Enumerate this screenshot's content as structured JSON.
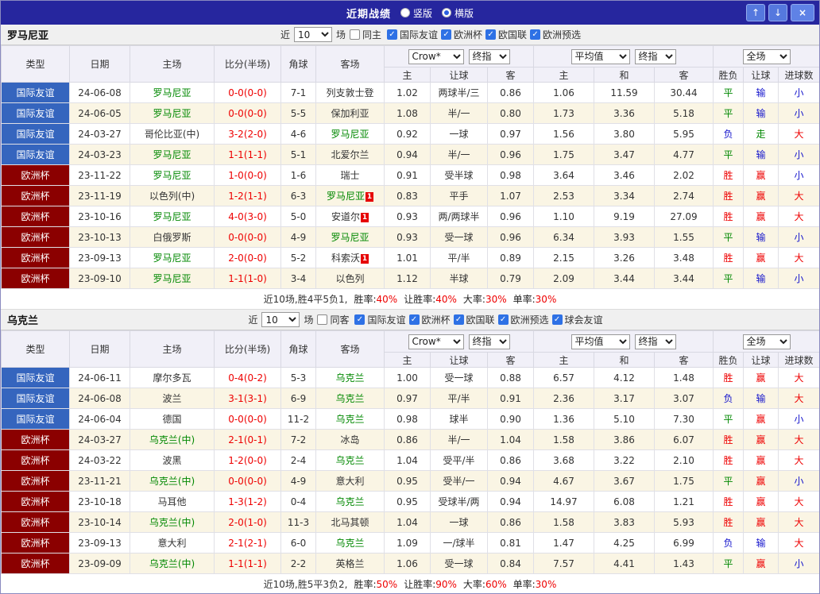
{
  "titlebar": {
    "title": "近期战绩",
    "radios": [
      {
        "label": "竖版",
        "selected": false
      },
      {
        "label": "横版",
        "selected": true
      }
    ],
    "buttons": {
      "up": "↑",
      "down": "↓",
      "close": "×"
    }
  },
  "type_colors": {
    "国际友谊": "#3565be",
    "欧洲杯": "#8b0000"
  },
  "result_colors": {
    "胜": "red",
    "平": "green",
    "负": "blue",
    "赢": "red",
    "走": "green",
    "输": "blue",
    "大": "red",
    "小": "blue"
  },
  "table": {
    "cols": {
      "type": "类型",
      "date": "日期",
      "home": "主场",
      "score": "比分(半场)",
      "corner": "角球",
      "away": "客场"
    },
    "selects": {
      "company": "Crow*",
      "stage1": "终指",
      "average": "平均值",
      "stage2": "终指",
      "scope": "全场"
    },
    "sub": [
      "主",
      "让球",
      "客",
      "主",
      "和",
      "客",
      "胜负",
      "让球",
      "进球数"
    ]
  },
  "sections": [
    {
      "team": "罗马尼亚",
      "filters": {
        "near_label": "近",
        "count": "10",
        "games_label": "场",
        "same": {
          "label": "同主",
          "checked": false
        },
        "comps": [
          {
            "label": "国际友谊",
            "checked": true
          },
          {
            "label": "欧洲杯",
            "checked": true
          },
          {
            "label": "欧国联",
            "checked": true
          },
          {
            "label": "欧洲预选",
            "checked": true
          }
        ]
      },
      "rows": [
        {
          "type": "国际友谊",
          "date": "24-06-08",
          "home": {
            "name": "罗马尼亚",
            "hl": true
          },
          "score": "0-0(0-0)",
          "corner": "7-1",
          "away": {
            "name": "列支敦士登",
            "hl": false
          },
          "odds": [
            "1.02",
            "两球半/三",
            "0.86",
            "1.06",
            "11.59",
            "30.44"
          ],
          "results": [
            "平",
            "输",
            "小"
          ]
        },
        {
          "type": "国际友谊",
          "date": "24-06-05",
          "home": {
            "name": "罗马尼亚",
            "hl": true
          },
          "score": "0-0(0-0)",
          "corner": "5-5",
          "away": {
            "name": "保加利亚",
            "hl": false
          },
          "odds": [
            "1.08",
            "半/一",
            "0.80",
            "1.73",
            "3.36",
            "5.18"
          ],
          "results": [
            "平",
            "输",
            "小"
          ]
        },
        {
          "type": "国际友谊",
          "date": "24-03-27",
          "home": {
            "name": "哥伦比亚(中)",
            "hl": false
          },
          "score": "3-2(2-0)",
          "corner": "4-6",
          "away": {
            "name": "罗马尼亚",
            "hl": true
          },
          "odds": [
            "0.92",
            "一球",
            "0.97",
            "1.56",
            "3.80",
            "5.95"
          ],
          "results": [
            "负",
            "走",
            "大"
          ]
        },
        {
          "type": "国际友谊",
          "date": "24-03-23",
          "home": {
            "name": "罗马尼亚",
            "hl": true
          },
          "score": "1-1(1-1)",
          "corner": "5-1",
          "away": {
            "name": "北爱尔兰",
            "hl": false
          },
          "odds": [
            "0.94",
            "半/一",
            "0.96",
            "1.75",
            "3.47",
            "4.77"
          ],
          "results": [
            "平",
            "输",
            "小"
          ]
        },
        {
          "type": "欧洲杯",
          "date": "23-11-22",
          "home": {
            "name": "罗马尼亚",
            "hl": true
          },
          "score": "1-0(0-0)",
          "corner": "1-6",
          "away": {
            "name": "瑞士",
            "hl": false
          },
          "odds": [
            "0.91",
            "受半球",
            "0.98",
            "3.64",
            "3.46",
            "2.02"
          ],
          "results": [
            "胜",
            "赢",
            "小"
          ]
        },
        {
          "type": "欧洲杯",
          "date": "23-11-19",
          "home": {
            "name": "以色列(中)",
            "hl": false
          },
          "score": "1-2(1-1)",
          "corner": "6-3",
          "away": {
            "name": "罗马尼亚",
            "hl": true,
            "card": "1"
          },
          "odds": [
            "0.83",
            "平手",
            "1.07",
            "2.53",
            "3.34",
            "2.74"
          ],
          "results": [
            "胜",
            "赢",
            "大"
          ]
        },
        {
          "type": "欧洲杯",
          "date": "23-10-16",
          "home": {
            "name": "罗马尼亚",
            "hl": true
          },
          "score": "4-0(3-0)",
          "corner": "5-0",
          "away": {
            "name": "安道尔",
            "hl": false,
            "card": "1"
          },
          "odds": [
            "0.93",
            "两/两球半",
            "0.96",
            "1.10",
            "9.19",
            "27.09"
          ],
          "results": [
            "胜",
            "赢",
            "大"
          ]
        },
        {
          "type": "欧洲杯",
          "date": "23-10-13",
          "home": {
            "name": "白俄罗斯",
            "hl": false
          },
          "score": "0-0(0-0)",
          "corner": "4-9",
          "away": {
            "name": "罗马尼亚",
            "hl": true
          },
          "odds": [
            "0.93",
            "受一球",
            "0.96",
            "6.34",
            "3.93",
            "1.55"
          ],
          "results": [
            "平",
            "输",
            "小"
          ]
        },
        {
          "type": "欧洲杯",
          "date": "23-09-13",
          "home": {
            "name": "罗马尼亚",
            "hl": true
          },
          "score": "2-0(0-0)",
          "corner": "5-2",
          "away": {
            "name": "科索沃",
            "hl": false,
            "card": "1"
          },
          "odds": [
            "1.01",
            "平/半",
            "0.89",
            "2.15",
            "3.26",
            "3.48"
          ],
          "results": [
            "胜",
            "赢",
            "大"
          ]
        },
        {
          "type": "欧洲杯",
          "date": "23-09-10",
          "home": {
            "name": "罗马尼亚",
            "hl": true
          },
          "score": "1-1(1-0)",
          "corner": "3-4",
          "away": {
            "name": "以色列",
            "hl": false
          },
          "odds": [
            "1.12",
            "半球",
            "0.79",
            "2.09",
            "3.44",
            "3.44"
          ],
          "results": [
            "平",
            "输",
            "小"
          ]
        }
      ],
      "footer": {
        "summary": "近10场,胜4平5负1,",
        "stats": [
          {
            "label": "胜率:",
            "value": "40%"
          },
          {
            "label": "让胜率:",
            "value": "40%"
          },
          {
            "label": "大率:",
            "value": "30%"
          },
          {
            "label": "单率:",
            "value": "30%"
          }
        ]
      }
    },
    {
      "team": "乌克兰",
      "filters": {
        "near_label": "近",
        "count": "10",
        "games_label": "场",
        "same": {
          "label": "同客",
          "checked": false
        },
        "comps": [
          {
            "label": "国际友谊",
            "checked": true
          },
          {
            "label": "欧洲杯",
            "checked": true
          },
          {
            "label": "欧国联",
            "checked": true
          },
          {
            "label": "欧洲预选",
            "checked": true
          },
          {
            "label": "球会友谊",
            "checked": true
          }
        ]
      },
      "rows": [
        {
          "type": "国际友谊",
          "date": "24-06-11",
          "home": {
            "name": "摩尔多瓦",
            "hl": false
          },
          "score": "0-4(0-2)",
          "corner": "5-3",
          "away": {
            "name": "乌克兰",
            "hl": true
          },
          "odds": [
            "1.00",
            "受一球",
            "0.88",
            "6.57",
            "4.12",
            "1.48"
          ],
          "results": [
            "胜",
            "赢",
            "大"
          ]
        },
        {
          "type": "国际友谊",
          "date": "24-06-08",
          "home": {
            "name": "波兰",
            "hl": false
          },
          "score": "3-1(3-1)",
          "corner": "6-9",
          "away": {
            "name": "乌克兰",
            "hl": true
          },
          "odds": [
            "0.97",
            "平/半",
            "0.91",
            "2.36",
            "3.17",
            "3.07"
          ],
          "results": [
            "负",
            "输",
            "大"
          ]
        },
        {
          "type": "国际友谊",
          "date": "24-06-04",
          "home": {
            "name": "德国",
            "hl": false
          },
          "score": "0-0(0-0)",
          "corner": "11-2",
          "away": {
            "name": "乌克兰",
            "hl": true
          },
          "odds": [
            "0.98",
            "球半",
            "0.90",
            "1.36",
            "5.10",
            "7.30"
          ],
          "results": [
            "平",
            "赢",
            "小"
          ]
        },
        {
          "type": "欧洲杯",
          "date": "24-03-27",
          "home": {
            "name": "乌克兰(中)",
            "hl": true
          },
          "score": "2-1(0-1)",
          "corner": "7-2",
          "away": {
            "name": "冰岛",
            "hl": false
          },
          "odds": [
            "0.86",
            "半/一",
            "1.04",
            "1.58",
            "3.86",
            "6.07"
          ],
          "results": [
            "胜",
            "赢",
            "大"
          ]
        },
        {
          "type": "欧洲杯",
          "date": "24-03-22",
          "home": {
            "name": "波黑",
            "hl": false
          },
          "score": "1-2(0-0)",
          "corner": "2-4",
          "away": {
            "name": "乌克兰",
            "hl": true
          },
          "odds": [
            "1.04",
            "受平/半",
            "0.86",
            "3.68",
            "3.22",
            "2.10"
          ],
          "results": [
            "胜",
            "赢",
            "大"
          ]
        },
        {
          "type": "欧洲杯",
          "date": "23-11-21",
          "home": {
            "name": "乌克兰(中)",
            "hl": true
          },
          "score": "0-0(0-0)",
          "corner": "4-9",
          "away": {
            "name": "意大利",
            "hl": false
          },
          "odds": [
            "0.95",
            "受半/一",
            "0.94",
            "4.67",
            "3.67",
            "1.75"
          ],
          "results": [
            "平",
            "赢",
            "小"
          ]
        },
        {
          "type": "欧洲杯",
          "date": "23-10-18",
          "home": {
            "name": "马耳他",
            "hl": false
          },
          "score": "1-3(1-2)",
          "corner": "0-4",
          "away": {
            "name": "乌克兰",
            "hl": true
          },
          "odds": [
            "0.95",
            "受球半/两",
            "0.94",
            "14.97",
            "6.08",
            "1.21"
          ],
          "results": [
            "胜",
            "赢",
            "大"
          ]
        },
        {
          "type": "欧洲杯",
          "date": "23-10-14",
          "home": {
            "name": "乌克兰(中)",
            "hl": true
          },
          "score": "2-0(1-0)",
          "corner": "11-3",
          "away": {
            "name": "北马其顿",
            "hl": false
          },
          "odds": [
            "1.04",
            "一球",
            "0.86",
            "1.58",
            "3.83",
            "5.93"
          ],
          "results": [
            "胜",
            "赢",
            "大"
          ]
        },
        {
          "type": "欧洲杯",
          "date": "23-09-13",
          "home": {
            "name": "意大利",
            "hl": false
          },
          "score": "2-1(2-1)",
          "corner": "6-0",
          "away": {
            "name": "乌克兰",
            "hl": true
          },
          "odds": [
            "1.09",
            "一/球半",
            "0.81",
            "1.47",
            "4.25",
            "6.99"
          ],
          "results": [
            "负",
            "输",
            "大"
          ]
        },
        {
          "type": "欧洲杯",
          "date": "23-09-09",
          "home": {
            "name": "乌克兰(中)",
            "hl": true
          },
          "score": "1-1(1-1)",
          "corner": "2-2",
          "away": {
            "name": "英格兰",
            "hl": false
          },
          "odds": [
            "1.06",
            "受一球",
            "0.84",
            "7.57",
            "4.41",
            "1.43"
          ],
          "results": [
            "平",
            "赢",
            "小"
          ]
        }
      ],
      "footer": {
        "summary": "近10场,胜5平3负2,",
        "stats": [
          {
            "label": "胜率:",
            "value": "50%"
          },
          {
            "label": "让胜率:",
            "value": "90%"
          },
          {
            "label": "大率:",
            "value": "60%"
          },
          {
            "label": "单率:",
            "value": "30%"
          }
        ]
      }
    }
  ]
}
